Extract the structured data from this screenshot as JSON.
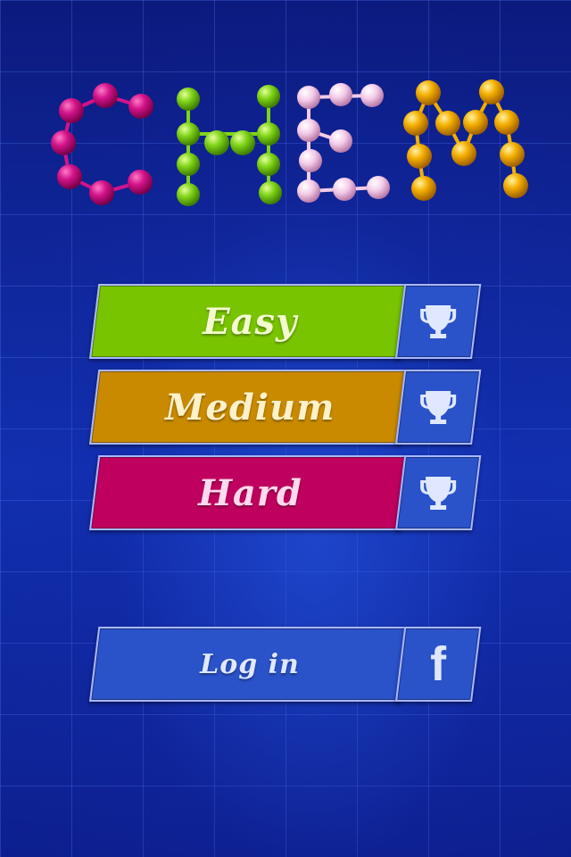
{
  "logo": {
    "text": "CHEM",
    "colors": {
      "C": "#c4127a",
      "H": "#6ed21a",
      "E": "#f2c6e6",
      "M": "#f2a800"
    }
  },
  "menu": {
    "easy": {
      "label": "Easy",
      "color": "#78c400",
      "icon": "trophy-icon"
    },
    "medium": {
      "label": "Medium",
      "color": "#c98a00",
      "icon": "trophy-icon"
    },
    "hard": {
      "label": "Hard",
      "color": "#c0005e",
      "icon": "trophy-icon"
    },
    "login": {
      "label": "Log in",
      "color": "#2a52c9",
      "icon": "facebook-icon",
      "icon_glyph": "f"
    }
  },
  "theme": {
    "background": "#0d1f8a",
    "grid": "#3a5ad8",
    "border": "#a9b8ff",
    "side_button": "#2a52c9"
  }
}
